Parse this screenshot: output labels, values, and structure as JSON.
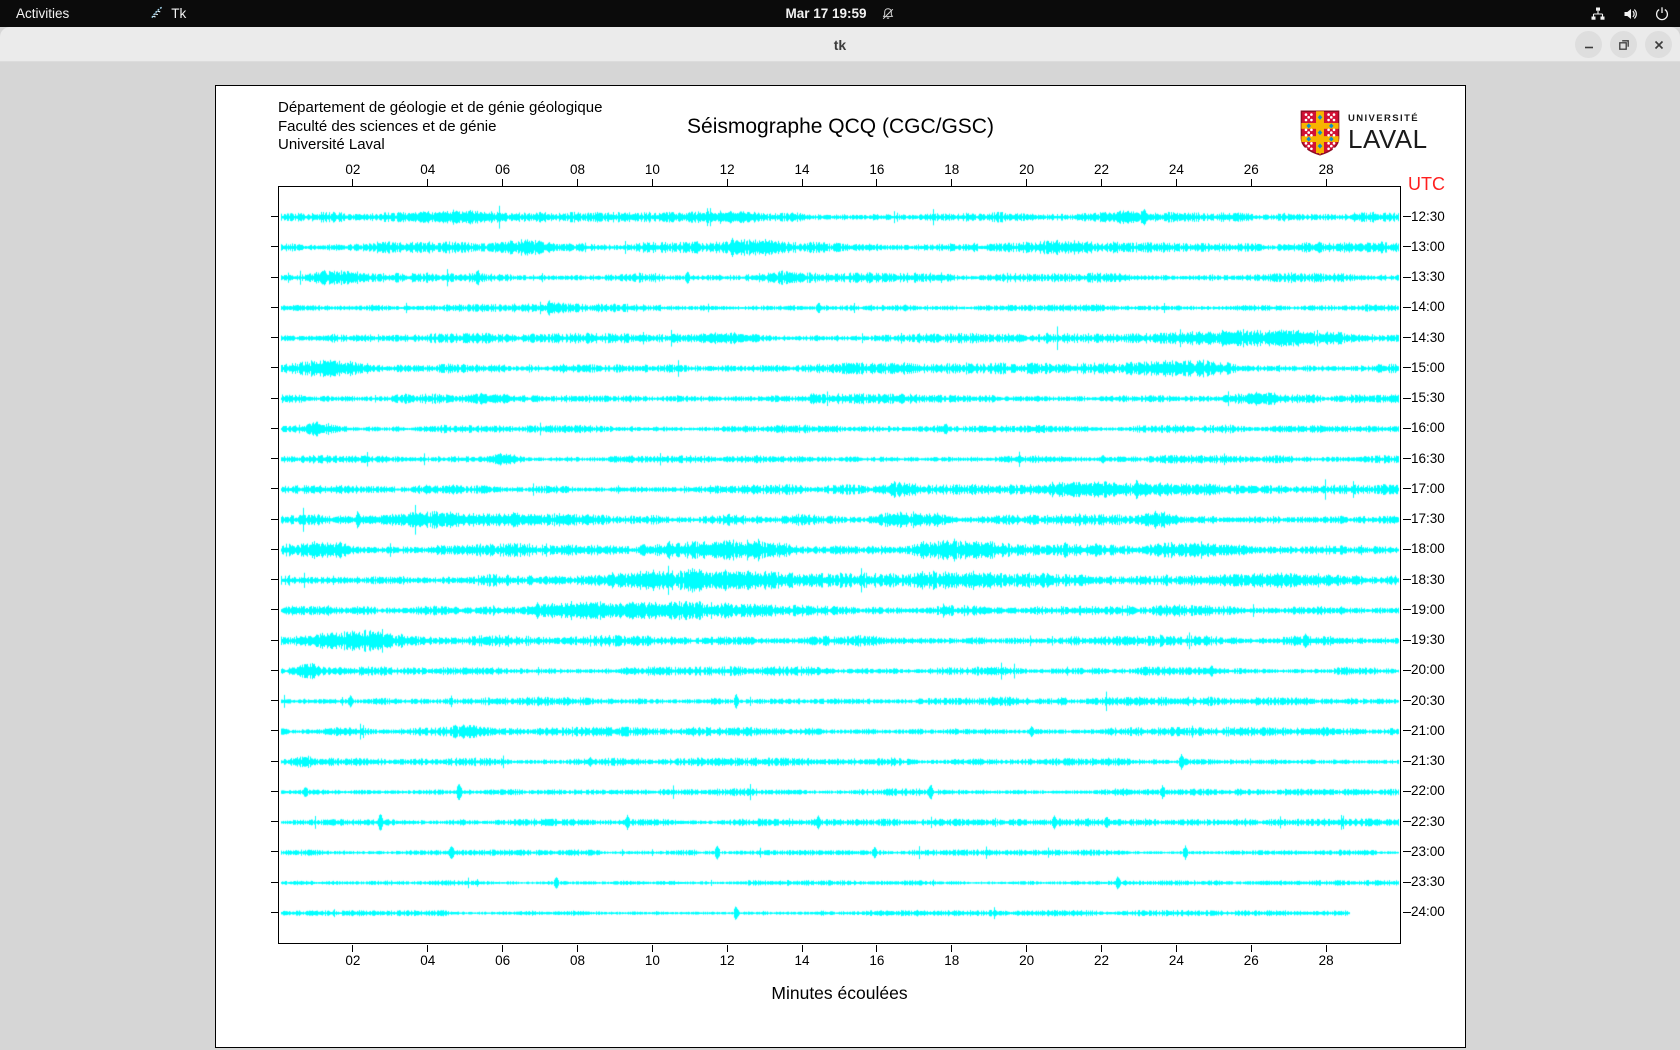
{
  "topbar": {
    "activities": "Activities",
    "app_name": "Tk",
    "clock": "Mar 17 19:59",
    "icons": [
      "tk-feather-icon",
      "notifications-disabled-icon",
      "network-wired-icon",
      "volume-icon",
      "power-icon"
    ]
  },
  "window": {
    "title": "tk",
    "buttons": [
      "minimize",
      "maximize",
      "close"
    ]
  },
  "seismograph": {
    "header_lines": [
      "Département de géologie et de génie géologique",
      "Faculté des sciences et de génie",
      "Université Laval"
    ],
    "title": "Séismographe QCQ (CGC/GSC)",
    "utc_label": "UTC",
    "utc_color": "#ff1f1f",
    "xlabel": "Minutes écoulées",
    "trace_color": "#00ffff",
    "logo": {
      "small_text": "UNIVERSITÉ",
      "large_text": "LAVAL",
      "red": "#d21034",
      "gold": "#f7b500",
      "blue": "#0a8fcd"
    }
  },
  "chart_data": {
    "type": "line",
    "subtype": "seismogram-helicorder",
    "title": "Séismographe QCQ (CGC/GSC)",
    "xlabel": "Minutes écoulées",
    "x_range_minutes": [
      0,
      30
    ],
    "x_ticks": [
      "02",
      "04",
      "06",
      "08",
      "10",
      "12",
      "14",
      "16",
      "18",
      "20",
      "22",
      "24",
      "26",
      "28"
    ],
    "right_axis_label": "UTC",
    "trace_color": "#00ffff",
    "rows": [
      {
        "utc": "12:30",
        "base": 2.4,
        "end": 30,
        "bursts": [
          [
            3.3,
            6.3,
            3.2
          ],
          [
            10.8,
            13,
            2.8
          ],
          [
            21.5,
            23.5,
            2.6
          ]
        ],
        "spikes": [
          [
            23.1,
            9
          ]
        ]
      },
      {
        "utc": "13:00",
        "base": 2.7,
        "end": 30,
        "bursts": [
          [
            5.8,
            7.2,
            3.6
          ],
          [
            11.8,
            13.6,
            4.0
          ],
          [
            20,
            22,
            2.5
          ]
        ],
        "spikes": [
          [
            6.2,
            8
          ],
          [
            12.1,
            10
          ]
        ]
      },
      {
        "utc": "13:30",
        "base": 2.4,
        "end": 30,
        "bursts": [
          [
            0.6,
            2.6,
            3.4
          ],
          [
            13,
            14,
            2.5
          ]
        ],
        "spikes": [
          [
            5.3,
            9
          ],
          [
            10.9,
            7
          ]
        ]
      },
      {
        "utc": "14:00",
        "base": 1.9,
        "end": 30,
        "bursts": [
          [
            7,
            7.8,
            2.5
          ]
        ],
        "spikes": [
          [
            7.2,
            8
          ],
          [
            14.4,
            6
          ]
        ]
      },
      {
        "utc": "14:30",
        "base": 2.4,
        "end": 30,
        "bursts": [
          [
            10.8,
            13,
            3.0
          ],
          [
            23.5,
            29.5,
            3.8
          ]
        ],
        "spikes": [
          [
            25.2,
            9
          ],
          [
            28.3,
            7
          ]
        ]
      },
      {
        "utc": "15:00",
        "base": 2.7,
        "end": 30,
        "bursts": [
          [
            0.2,
            2.6,
            3.8
          ],
          [
            22.5,
            26,
            3.0
          ]
        ],
        "spikes": [
          [
            24.8,
            8
          ],
          [
            1.2,
            7
          ]
        ]
      },
      {
        "utc": "15:30",
        "base": 2.4,
        "end": 30,
        "bursts": [
          [
            4.8,
            6.2,
            3.0
          ],
          [
            25,
            27,
            2.5
          ]
        ],
        "spikes": [
          [
            5.4,
            7
          ],
          [
            26.1,
            7
          ]
        ]
      },
      {
        "utc": "16:00",
        "base": 1.9,
        "end": 30,
        "bursts": [
          [
            0.6,
            1.6,
            3.4
          ]
        ],
        "spikes": [
          [
            1.0,
            9
          ],
          [
            17.8,
            6
          ]
        ]
      },
      {
        "utc": "16:30",
        "base": 1.9,
        "end": 30,
        "bursts": [
          [
            5.4,
            6.6,
            2.8
          ]
        ],
        "spikes": [
          [
            5.9,
            7
          ],
          [
            22,
            5
          ]
        ]
      },
      {
        "utc": "17:00",
        "base": 2.4,
        "end": 30,
        "bursts": [
          [
            15.8,
            17.2,
            3.2
          ],
          [
            20,
            25.3,
            4.6
          ]
        ],
        "spikes": [
          [
            21.2,
            9
          ],
          [
            22.9,
            10
          ]
        ]
      },
      {
        "utc": "17:30",
        "base": 2.9,
        "end": 30,
        "bursts": [
          [
            1.4,
            9,
            3.8
          ],
          [
            15.8,
            18.2,
            3.8
          ],
          [
            22.8,
            24.2,
            3.4
          ]
        ],
        "spikes": [
          [
            2.1,
            9
          ],
          [
            23.4,
            9
          ]
        ]
      },
      {
        "utc": "18:00",
        "base": 3.4,
        "end": 30,
        "bursts": [
          [
            0,
            2.2,
            4.2
          ],
          [
            9.4,
            14,
            4.8
          ],
          [
            16.8,
            19.2,
            4.4
          ],
          [
            22.8,
            26.2,
            4.0
          ]
        ],
        "spikes": [
          [
            10.4,
            10
          ],
          [
            18.9,
            9
          ]
        ]
      },
      {
        "utc": "18:30",
        "base": 3.4,
        "end": 30,
        "bursts": [
          [
            7.8,
            14.2,
            4.4
          ],
          [
            16.8,
            19.8,
            4.0
          ],
          [
            24.8,
            28.6,
            4.4
          ]
        ],
        "spikes": [
          [
            8.9,
            9
          ],
          [
            26.2,
            8
          ]
        ]
      },
      {
        "utc": "19:00",
        "base": 2.9,
        "end": 30,
        "bursts": [
          [
            5.8,
            13.2,
            4.0
          ]
        ],
        "spikes": [
          [
            6.9,
            9
          ],
          [
            12.7,
            8
          ]
        ]
      },
      {
        "utc": "19:30",
        "base": 2.7,
        "end": 30,
        "bursts": [
          [
            0.2,
            3.9,
            6.0
          ]
        ],
        "spikes": [
          [
            1.4,
            10
          ],
          [
            27.4,
            8
          ]
        ]
      },
      {
        "utc": "20:00",
        "base": 2.1,
        "end": 30,
        "bursts": [
          [
            0.2,
            1.3,
            4.0
          ]
        ],
        "spikes": [
          [
            0.7,
            8
          ],
          [
            24.9,
            6
          ]
        ]
      },
      {
        "utc": "20:30",
        "base": 2.1,
        "end": 30,
        "bursts": [],
        "spikes": [
          [
            1.9,
            6
          ],
          [
            12.2,
            7
          ],
          [
            19.5,
            5
          ]
        ]
      },
      {
        "utc": "21:00",
        "base": 2.1,
        "end": 30,
        "bursts": [
          [
            4.4,
            5.6,
            3.0
          ]
        ],
        "spikes": [
          [
            4.7,
            8
          ],
          [
            20.1,
            6
          ]
        ]
      },
      {
        "utc": "21:30",
        "base": 1.9,
        "end": 30,
        "bursts": [
          [
            0.2,
            1.1,
            3.0
          ]
        ],
        "spikes": [
          [
            24.1,
            8
          ],
          [
            8.3,
            5
          ]
        ]
      },
      {
        "utc": "22:00",
        "base": 1.7,
        "end": 30,
        "bursts": [],
        "spikes": [
          [
            0.7,
            6
          ],
          [
            4.8,
            9
          ],
          [
            17.4,
            8
          ],
          [
            23.6,
            7
          ]
        ]
      },
      {
        "utc": "22:30",
        "base": 1.7,
        "end": 30,
        "bursts": [],
        "spikes": [
          [
            2.7,
            9
          ],
          [
            9.3,
            7
          ],
          [
            14.4,
            7
          ],
          [
            20.7,
            7
          ],
          [
            22.1,
            6
          ]
        ]
      },
      {
        "utc": "23:00",
        "base": 1.4,
        "end": 30,
        "bursts": [],
        "spikes": [
          [
            4.6,
            8
          ],
          [
            11.7,
            7
          ],
          [
            15.9,
            6
          ],
          [
            24.2,
            7
          ]
        ]
      },
      {
        "utc": "23:30",
        "base": 1.2,
        "end": 30,
        "bursts": [],
        "spikes": [
          [
            7.4,
            6
          ],
          [
            22.4,
            7
          ]
        ]
      },
      {
        "utc": "24:00",
        "base": 1.4,
        "end": 28.6,
        "bursts": [],
        "spikes": [
          [
            12.2,
            7
          ]
        ]
      }
    ]
  }
}
